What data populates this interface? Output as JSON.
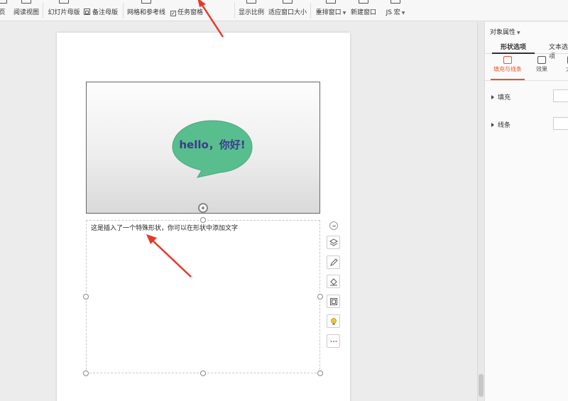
{
  "ribbon": {
    "page_view": "页",
    "reading_view": "阅读视图",
    "slide_master": "幻灯片母版",
    "notes_master": "备注母版",
    "grid_guides": "网格和参考线",
    "task_pane": "任务窗格",
    "task_pane_check": "✓",
    "zoom": "显示比例",
    "fit_window": "适应窗口大小",
    "rearrange_window": "重排窗口",
    "new_window": "新建窗口",
    "js_macro": "JS 宏"
  },
  "slide": {
    "bubble_text": "hello，你好!",
    "textbox_text": "这是插入了一个特殊形状，你可以在形状中添加文字"
  },
  "panel": {
    "title": "对象属性",
    "tabs": [
      "形状选项",
      "文本选项"
    ],
    "subtabs": [
      "填充与线条",
      "效果",
      "大小"
    ],
    "rows": [
      "填充",
      "线条"
    ]
  },
  "colors": {
    "bubble_fill": "#58be8e",
    "bubble_text": "#3e3a8e",
    "arrow": "#e53a2a",
    "accent": "#e4572e"
  }
}
